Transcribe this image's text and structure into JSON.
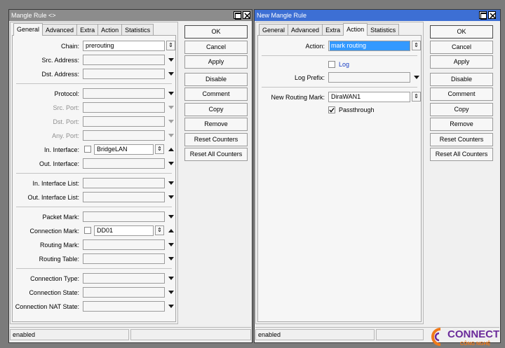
{
  "left_window": {
    "title": "Mangle Rule <>",
    "tabs": [
      "General",
      "Advanced",
      "Extra",
      "Action",
      "Statistics"
    ],
    "active_tab": "General",
    "fields": {
      "chain": {
        "label": "Chain:",
        "value": "prerouting"
      },
      "src_address": {
        "label": "Src. Address:",
        "value": ""
      },
      "dst_address": {
        "label": "Dst. Address:",
        "value": ""
      },
      "protocol": {
        "label": "Protocol:",
        "value": ""
      },
      "src_port": {
        "label": "Src. Port:",
        "value": ""
      },
      "dst_port": {
        "label": "Dst. Port:",
        "value": ""
      },
      "any_port": {
        "label": "Any. Port:",
        "value": ""
      },
      "in_interface": {
        "label": "In. Interface:",
        "value": "BridgeLAN"
      },
      "out_interface": {
        "label": "Out. Interface:",
        "value": ""
      },
      "in_interface_list": {
        "label": "In. Interface List:",
        "value": ""
      },
      "out_interface_list": {
        "label": "Out. Interface List:",
        "value": ""
      },
      "packet_mark": {
        "label": "Packet Mark:",
        "value": ""
      },
      "connection_mark": {
        "label": "Connection Mark:",
        "value": "DD01"
      },
      "routing_mark": {
        "label": "Routing Mark:",
        "value": ""
      },
      "routing_table": {
        "label": "Routing Table:",
        "value": ""
      },
      "connection_type": {
        "label": "Connection Type:",
        "value": ""
      },
      "connection_state": {
        "label": "Connection State:",
        "value": ""
      },
      "connection_nat_state": {
        "label": "Connection NAT State:",
        "value": ""
      }
    },
    "buttons": [
      "OK",
      "Cancel",
      "Apply",
      "Disable",
      "Comment",
      "Copy",
      "Remove",
      "Reset Counters",
      "Reset All Counters"
    ],
    "status": "enabled"
  },
  "right_window": {
    "title": "New Mangle Rule",
    "tabs": [
      "General",
      "Advanced",
      "Extra",
      "Action",
      "Statistics"
    ],
    "active_tab": "Action",
    "fields": {
      "action": {
        "label": "Action:",
        "value": "mark routing"
      },
      "log": {
        "label": "Log",
        "checked": false
      },
      "log_prefix": {
        "label": "Log Prefix:",
        "value": ""
      },
      "new_routing_mark": {
        "label": "New Routing Mark:",
        "value": "DiraWAN1"
      },
      "passthrough": {
        "label": "Passthrough",
        "checked": true
      }
    },
    "buttons": [
      "OK",
      "Cancel",
      "Apply",
      "Disable",
      "Comment",
      "Copy",
      "Remove",
      "Reset Counters",
      "Reset All Counters"
    ],
    "status": "enabled"
  },
  "logo": {
    "line1": "CONNECT",
    "line2": "CÔNG NGHỆ"
  },
  "colors": {
    "active_title": "#3d6fd4",
    "inactive_title": "#8c8c8c",
    "selection": "#3399ff",
    "desktop": "#7b7b7b",
    "logo_orange": "#f07a1a",
    "logo_purple": "#6a2a9a"
  }
}
